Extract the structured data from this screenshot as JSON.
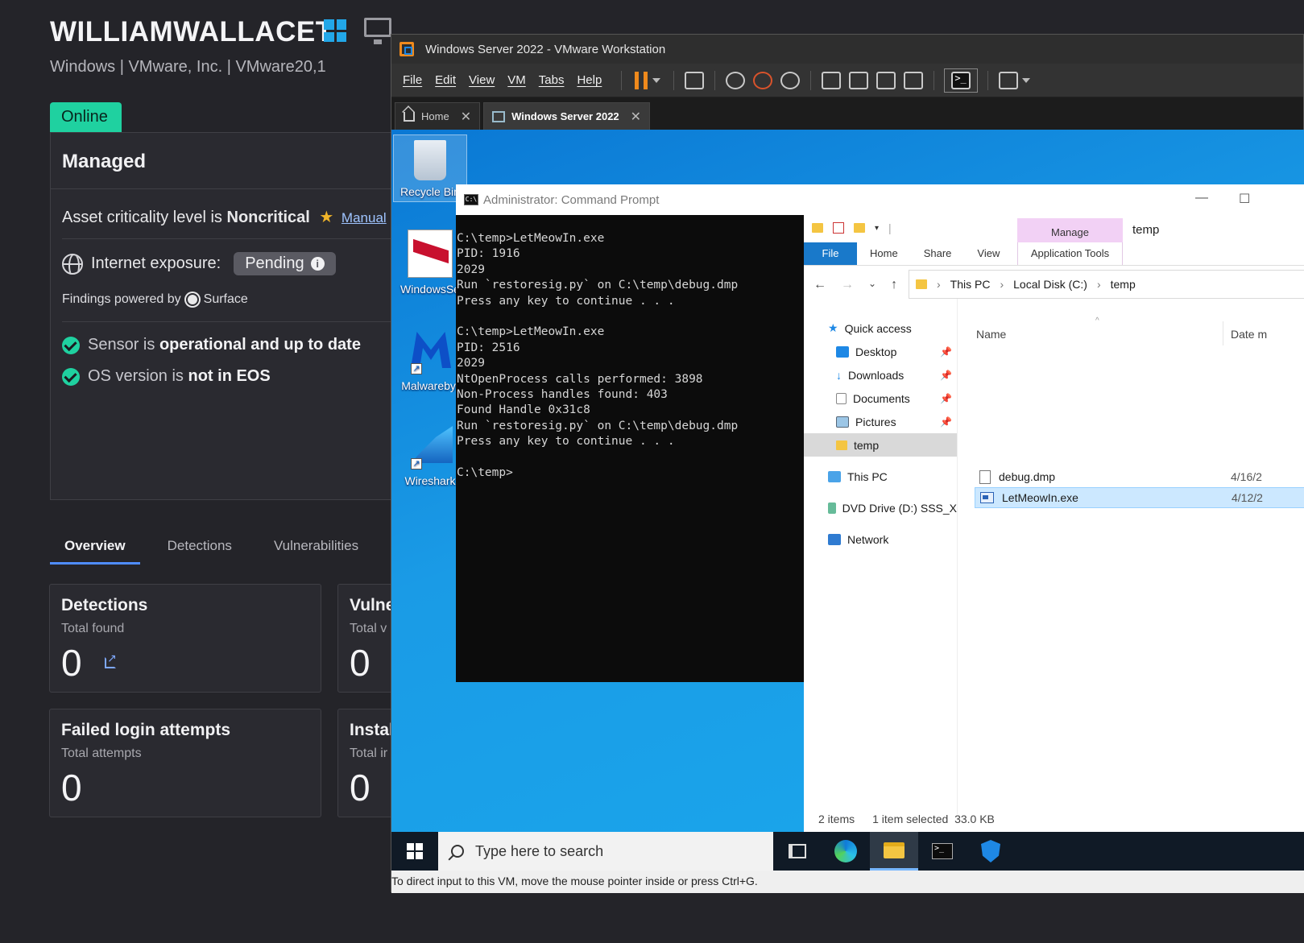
{
  "console": {
    "hostname": "WILLIAMWALLACET",
    "subtitle": "Windows | VMware, Inc. | VMware20,1",
    "status_tab": "Online",
    "managed_title": "Managed",
    "criticality_prefix": "Asset criticality level is ",
    "criticality_value": "Noncritical",
    "criticality_link": "Manual",
    "exposure_label": "Internet exposure:",
    "exposure_value": "Pending",
    "findings_prefix": "Findings powered by",
    "findings_source": "Surface",
    "sensor_prefix": "Sensor is ",
    "sensor_value": "operational and up to date",
    "os_prefix": "OS version is ",
    "os_value": "not in EOS",
    "tabs": [
      "Overview",
      "Detections",
      "Vulnerabilities"
    ],
    "cards": [
      {
        "title": "Detections",
        "sub": "Total found",
        "value": "0"
      },
      {
        "title": "Vulne",
        "sub": "Total v",
        "value": "0"
      },
      {
        "title": "Failed login attempts",
        "sub": "Total attempts",
        "value": "0"
      },
      {
        "title": "Instal",
        "sub": "Total ir",
        "value": "0"
      }
    ]
  },
  "vmware": {
    "title": "Windows Server 2022 - VMware Workstation",
    "menu": [
      "File",
      "Edit",
      "View",
      "VM",
      "Tabs",
      "Help"
    ],
    "tabs": [
      "Home",
      "Windows Server 2022"
    ],
    "status_bar": "To direct input to this VM, move the mouse pointer inside or press Ctrl+G."
  },
  "desktop": {
    "icons": [
      "Recycle Bin",
      "WindowsSe",
      "Malwarebyt",
      "Wireshark"
    ]
  },
  "cmd": {
    "title": "Administrator: Command Prompt",
    "output": "C:\\temp>LetMeowIn.exe\nPID: 1916\n2029\nRun `restoresig.py` on C:\\temp\\debug.dmp\nPress any key to continue . . .\n\nC:\\temp>LetMeowIn.exe\nPID: 2516\n2029\nNtOpenProcess calls performed: 3898\nNon-Process handles found: 403\nFound Handle 0x31c8\nRun `restoresig.py` on C:\\temp\\debug.dmp\nPress any key to continue . . .\n\nC:\\temp>"
  },
  "explorer": {
    "window_title": "temp",
    "ribbon_tabs": [
      "File",
      "Home",
      "Share",
      "View"
    ],
    "manage_label": "Manage",
    "app_tools_label": "Application Tools",
    "breadcrumb": [
      "This PC",
      "Local Disk (C:)",
      "temp"
    ],
    "tree": {
      "quick_access": "Quick access",
      "desktop": "Desktop",
      "downloads": "Downloads",
      "documents": "Documents",
      "pictures": "Pictures",
      "temp": "temp",
      "this_pc": "This PC",
      "dvd": "DVD Drive (D:) SSS_X",
      "network": "Network"
    },
    "columns": {
      "name": "Name",
      "date": "Date m"
    },
    "files": [
      {
        "name": "debug.dmp",
        "date": "4/16/2"
      },
      {
        "name": "LetMeowIn.exe",
        "date": "4/12/2"
      }
    ],
    "status_items": "2 items",
    "status_selected": "1 item selected  33.0 KB"
  },
  "taskbar": {
    "search_placeholder": "Type here to search"
  },
  "colors": {
    "online": "#1fd1a0",
    "vm_accent": "#f08a1c",
    "desktop_blue": "#0a78d4",
    "explorer_file_tab": "#1979ca"
  }
}
